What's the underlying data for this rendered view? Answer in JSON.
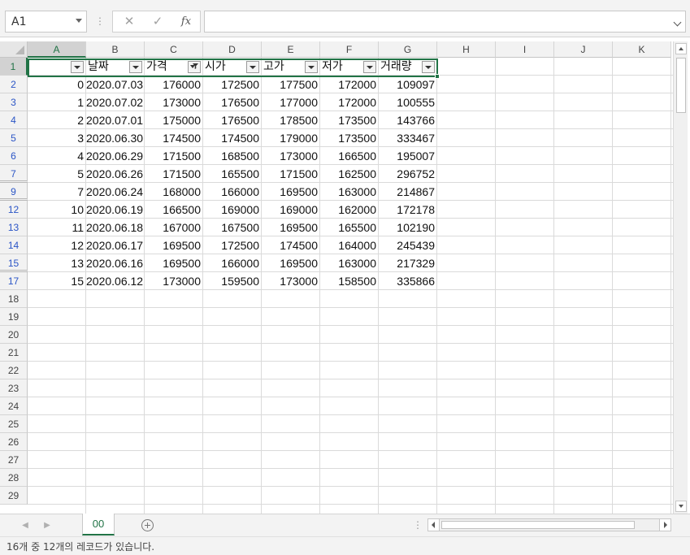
{
  "formula_bar": {
    "name_box": "A1",
    "cancel_icon": "✕",
    "enter_icon": "✓",
    "fx_label": "fx",
    "formula": ""
  },
  "columns": [
    "A",
    "B",
    "C",
    "D",
    "E",
    "F",
    "G",
    "H",
    "I",
    "J",
    "K"
  ],
  "selected_column": "A",
  "row_numbers": [
    "1",
    "2",
    "3",
    "4",
    "5",
    "6",
    "7",
    "9",
    "12",
    "13",
    "14",
    "15",
    "17",
    "18",
    "19",
    "20",
    "21",
    "22",
    "23",
    "24",
    "25",
    "26",
    "27",
    "28",
    "29"
  ],
  "table": {
    "headers": [
      "",
      "날짜",
      "가격",
      "시가",
      "고가",
      "저가",
      "거래량"
    ],
    "filtered_column_index": 2,
    "rows": [
      [
        "0",
        "2020.07.03",
        "176000",
        "172500",
        "177500",
        "172000",
        "109097"
      ],
      [
        "1",
        "2020.07.02",
        "173000",
        "176500",
        "177000",
        "172000",
        "100555"
      ],
      [
        "2",
        "2020.07.01",
        "175000",
        "176500",
        "178500",
        "173500",
        "143766"
      ],
      [
        "3",
        "2020.06.30",
        "174500",
        "174500",
        "179000",
        "173500",
        "333467"
      ],
      [
        "4",
        "2020.06.29",
        "171500",
        "168500",
        "173000",
        "166500",
        "195007"
      ],
      [
        "5",
        "2020.06.26",
        "171500",
        "165500",
        "171500",
        "162500",
        "296752"
      ],
      [
        "7",
        "2020.06.24",
        "168000",
        "166000",
        "169500",
        "163000",
        "214867"
      ],
      [
        "10",
        "2020.06.19",
        "166500",
        "169000",
        "169000",
        "162000",
        "172178"
      ],
      [
        "11",
        "2020.06.18",
        "167000",
        "167500",
        "169500",
        "165500",
        "102190"
      ],
      [
        "12",
        "2020.06.17",
        "169500",
        "172500",
        "174500",
        "164000",
        "245439"
      ],
      [
        "13",
        "2020.06.16",
        "169500",
        "166000",
        "169500",
        "163000",
        "217329"
      ],
      [
        "15",
        "2020.06.12",
        "173000",
        "159500",
        "173000",
        "158500",
        "335866"
      ]
    ]
  },
  "sheet_tabs": [
    "00"
  ],
  "status_bar": {
    "text": "16개 중 12개의 레코드가 있습니다."
  },
  "colors": {
    "accent": "#217346",
    "filtered_row_number": "#2b55c6"
  }
}
